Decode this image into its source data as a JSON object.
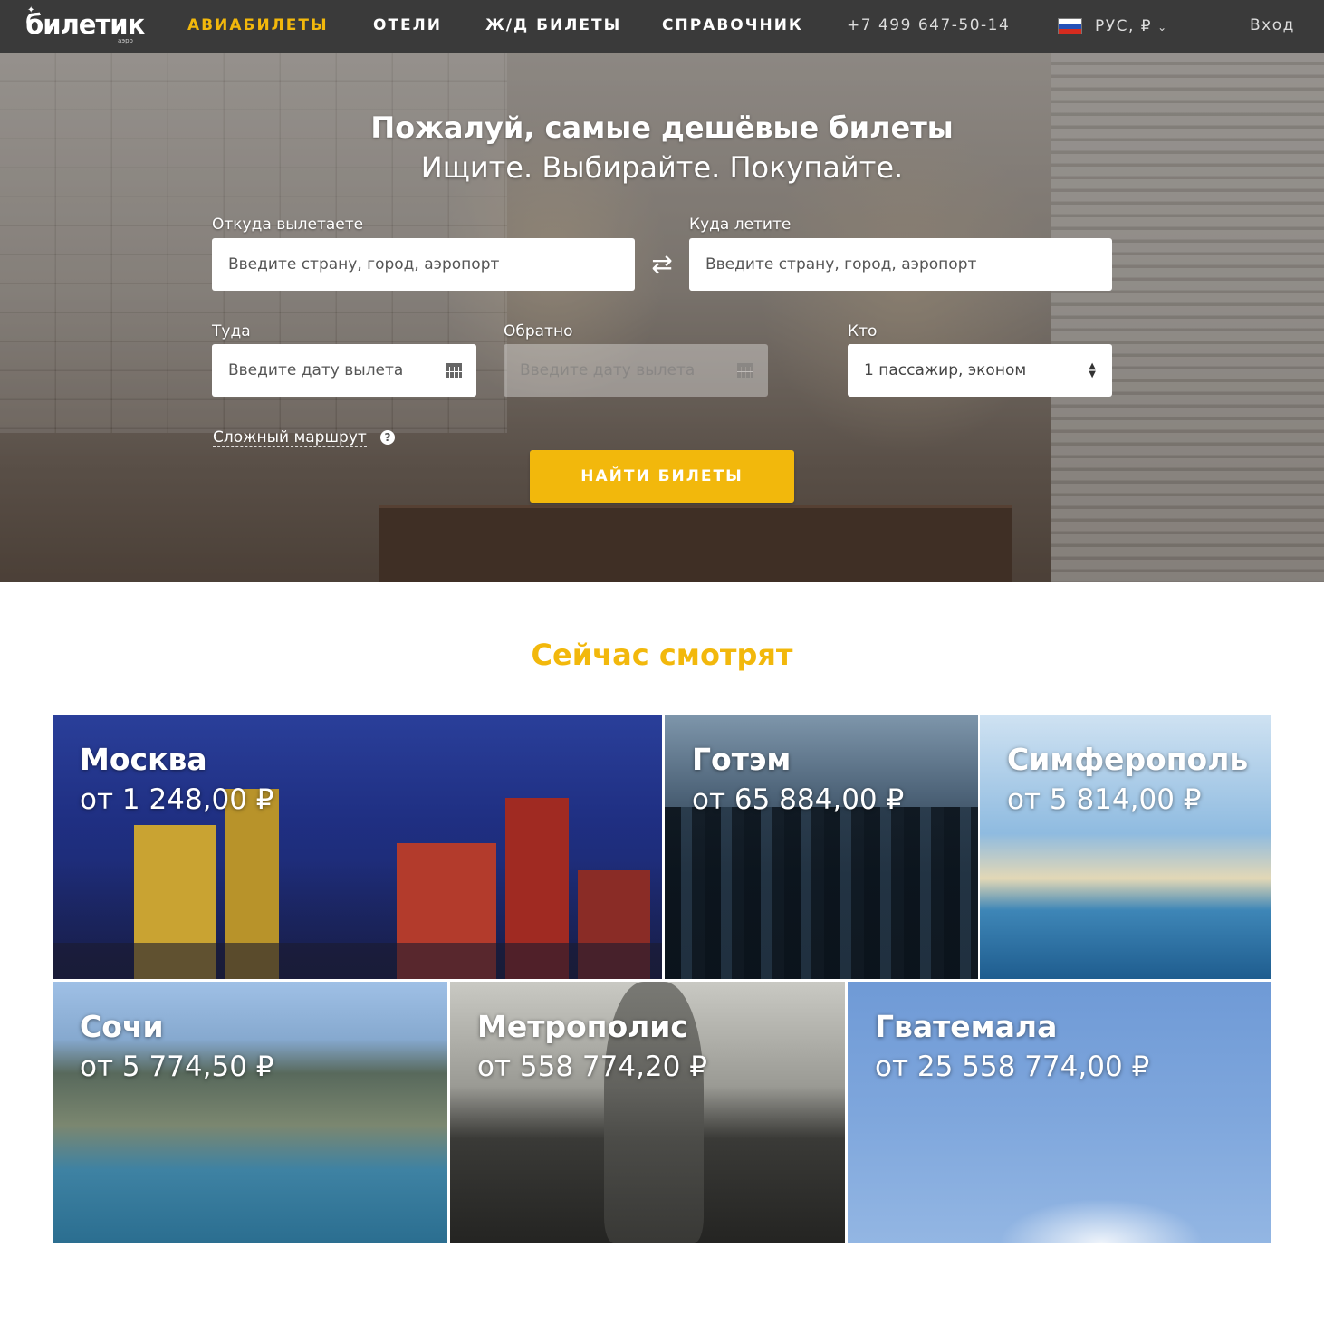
{
  "nav": {
    "logo": "билетик",
    "logo_sub": "аэро",
    "links": [
      "АВИАБИЛЕТЫ",
      "ОТЕЛИ",
      "Ж/Д БИЛЕТЫ",
      "СПРАВОЧНИК"
    ],
    "phone": "+7 499 647-50-14",
    "lang": "РУС, ₽",
    "login": "Вход"
  },
  "hero": {
    "title": "Пожалуй, самые дешёвые билеты",
    "subtitle": "Ищите. Выбирайте. Покупайте.",
    "from_label": "Откуда вылетаете",
    "from_placeholder": "Введите страну, город, аэропорт",
    "to_label": "Куда летите",
    "to_placeholder": "Введите страну, город, аэропорт",
    "depart_label": "Туда",
    "depart_placeholder": "Введите дату вылета",
    "return_label": "Обратно",
    "return_placeholder": "Введите дату вылета",
    "who_label": "Кто",
    "who_value": "1 пассажир, эконом",
    "complex_route": "Сложный маршрут",
    "search_button": "НАЙТИ БИЛЕТЫ"
  },
  "popular": {
    "title": "Сейчас смотрят",
    "cards": [
      {
        "city": "Москва",
        "price": "от 1 248,00 ₽"
      },
      {
        "city": "Готэм",
        "price": "от 65 884,00 ₽"
      },
      {
        "city": "Симферополь",
        "price": "от 5 814,00 ₽"
      },
      {
        "city": "Сочи",
        "price": "от 5 774,50 ₽"
      },
      {
        "city": "Метрополис",
        "price": "от 558 774,20 ₽"
      },
      {
        "city": "Гватемала",
        "price": "от 25 558 774,00 ₽"
      }
    ]
  },
  "colors": {
    "accent": "#f2b80c",
    "nav_bg": "#3a3a3a"
  },
  "icons": {
    "swap": "swap-arrows-icon",
    "calendar": "calendar-icon",
    "help": "question-circle-icon",
    "chevron": "chevron-down-icon"
  }
}
